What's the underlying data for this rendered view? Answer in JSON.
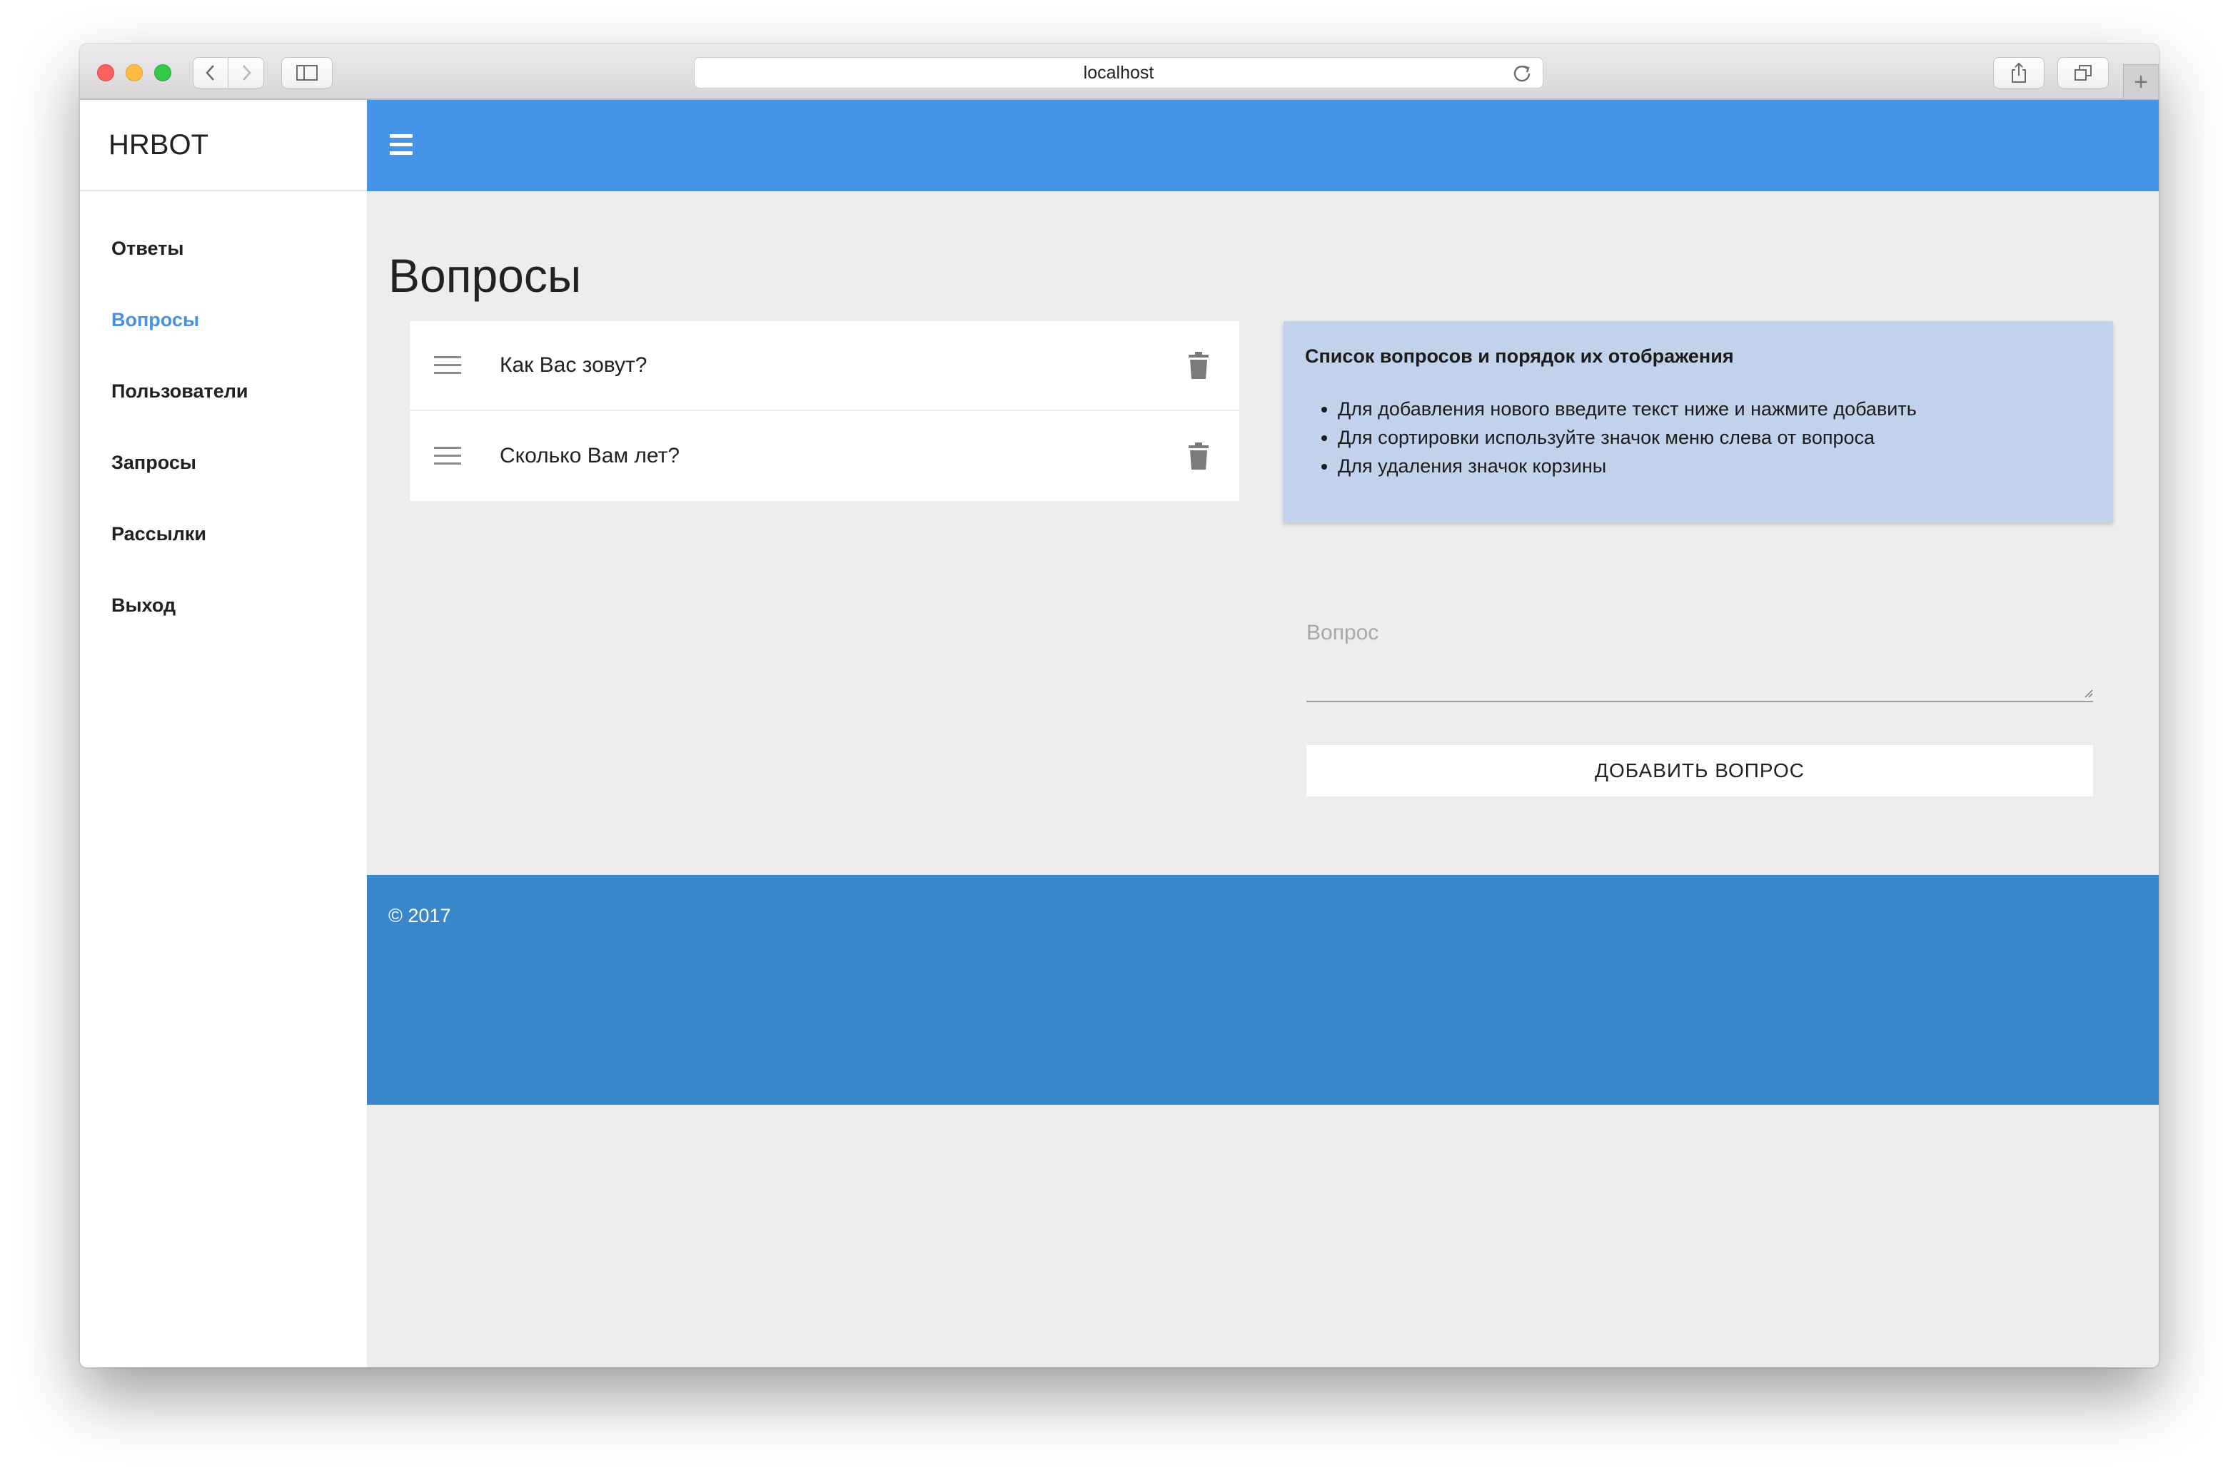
{
  "browser": {
    "url": "localhost"
  },
  "app": {
    "brand": "HRBOT"
  },
  "sidebar": {
    "items": [
      {
        "label": "Ответы",
        "active": false
      },
      {
        "label": "Вопросы",
        "active": true
      },
      {
        "label": "Пользователи",
        "active": false
      },
      {
        "label": "Запросы",
        "active": false
      },
      {
        "label": "Рассылки",
        "active": false
      },
      {
        "label": "Выход",
        "active": false
      }
    ]
  },
  "page": {
    "title": "Вопросы"
  },
  "questions": [
    {
      "text": "Как Вас зовут?"
    },
    {
      "text": "Сколько Вам лет?"
    }
  ],
  "info": {
    "title": "Список вопросов и порядок их отображения",
    "items": [
      "Для добавления нового введите текст ниже и нажмите добавить",
      "Для сортировки используйте значок меню слева от вопроса",
      "Для удаления значок корзины"
    ]
  },
  "form": {
    "question_placeholder": "Вопрос",
    "question_value": "",
    "add_button_label": "ДОБАВИТЬ ВОПРОС"
  },
  "footer": {
    "copyright": "© 2017"
  },
  "colors": {
    "header": "#4594ea",
    "footer": "#3887cb",
    "info_panel": "#c1d3ea",
    "active_nav": "#4a90e2"
  }
}
